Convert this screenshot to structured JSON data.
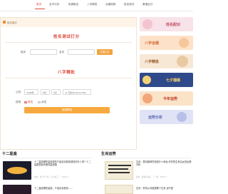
{
  "nav": {
    "items": [
      "首页",
      "全平行卦",
      "免费取名",
      "八字精批",
      "合婚测算",
      "姓名测试",
      "黄道吉日"
    ],
    "active_index": 0
  },
  "panel": {
    "crumb": "姓名测试"
  },
  "name_test": {
    "title": "姓名测试打分",
    "surname_label": "姓氏",
    "name_label": "名字",
    "button": "开始打分"
  },
  "bazi": {
    "title": "八字精批",
    "birth_label": "公历",
    "year": "1999年",
    "month": "8月",
    "day": "9日",
    "hour": "11 巳时(9:00-10:59)",
    "gender_label": "性别",
    "male": "男性",
    "female": "女性",
    "gender_selected": "男性",
    "button": "免费精批"
  },
  "banners": [
    {
      "text": "姓名配对",
      "bg": "#f7e3e9",
      "color": "#c24d63"
    },
    {
      "text": "八字合婚",
      "bg": "#fde2c9",
      "color": "#d2632b"
    },
    {
      "text": "八字精批",
      "bg": "#f7e8d6",
      "color": "#9c5a2b"
    },
    {
      "text": "七夕姻缘",
      "bg": "#2f4a8a",
      "color": "#ffd76a"
    },
    {
      "text": "今年运势",
      "bg": "#fbe3c8",
      "color": "#c23b2a"
    },
    {
      "text": "运势分析",
      "bg": "#dfe3f5",
      "color": "#5e6ab5"
    }
  ],
  "zodiac": {
    "title": "十二星座",
    "articles": [
      {
        "title": "十二星座哪些星座男的介绍喜欢看到感情的什么事？十二星座男最完美的星座婚",
        "meta": "发布：星卡不一样，小小的三一 · 2023-2"
      },
      {
        "title": "十二星座哪些星座，介绍喜欢看到……",
        "meta": ""
      }
    ]
  },
  "life": {
    "title": "生肖运势",
    "articles": [
      {
        "title": "生肖：属鸡猫咪究竟是什么命运 好好的生肖名女的运势分析",
        "meta": "发布：看看生肖好，了一些 · 2023-2"
      },
      {
        "title": "生肖：邪虫从你造属哪个生肖 运气是",
        "meta": ""
      }
    ]
  }
}
